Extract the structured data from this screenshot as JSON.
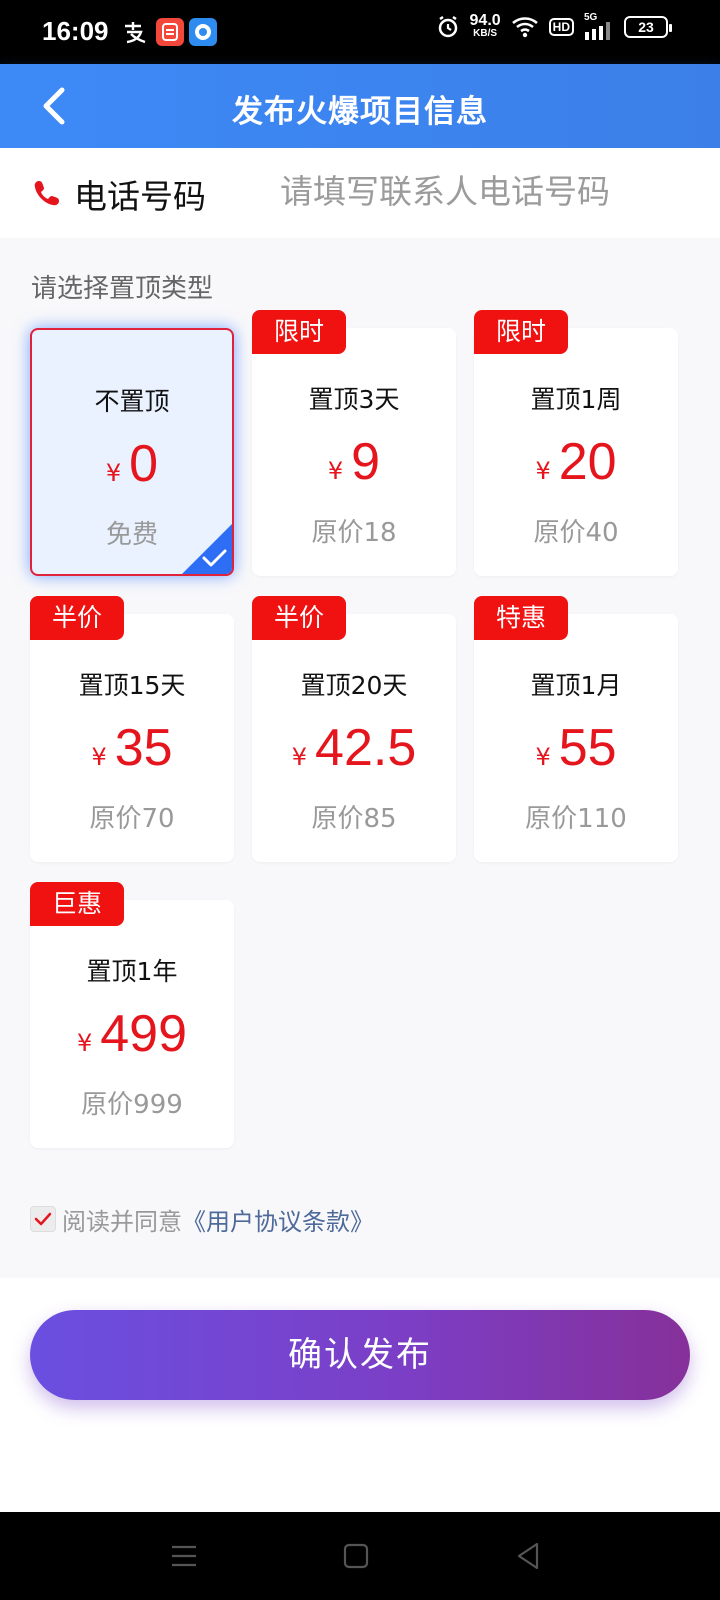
{
  "status_bar": {
    "time": "16:09",
    "speed_top": "94.0",
    "speed_bottom": "KB/S",
    "hd": "HD",
    "net": "5G",
    "battery": "23"
  },
  "header": {
    "title": "发布火爆项目信息"
  },
  "phone": {
    "label": "电话号码",
    "placeholder": "请填写联系人电话号码"
  },
  "section": {
    "title": "请选择置顶类型"
  },
  "options": [
    {
      "badge": "",
      "name": "不置顶",
      "currency": "¥",
      "price": "0",
      "original": "免费",
      "selected": true
    },
    {
      "badge": "限时",
      "name": "置顶3天",
      "currency": "¥",
      "price": "9",
      "original": "原价18",
      "selected": false
    },
    {
      "badge": "限时",
      "name": "置顶1周",
      "currency": "¥",
      "price": "20",
      "original": "原价40",
      "selected": false
    },
    {
      "badge": "半价",
      "name": "置顶15天",
      "currency": "¥",
      "price": "35",
      "original": "原价70",
      "selected": false
    },
    {
      "badge": "半价",
      "name": "置顶20天",
      "currency": "¥",
      "price": "42.5",
      "original": "原价85",
      "selected": false
    },
    {
      "badge": "特惠",
      "name": "置顶1月",
      "currency": "¥",
      "price": "55",
      "original": "原价110",
      "selected": false
    },
    {
      "badge": "巨惠",
      "name": "置顶1年",
      "currency": "¥",
      "price": "499",
      "original": "原价999",
      "selected": false
    }
  ],
  "agreement": {
    "checked": true,
    "text": "阅读并同意",
    "link": "《用户协议条款》"
  },
  "confirm": {
    "label": "确认发布"
  },
  "colors": {
    "primary": "#3d8af7",
    "accent_red": "#e5151d",
    "badge_red": "#f01111",
    "button_start": "#6a4fe0",
    "button_end": "#86309a"
  },
  "icons": {
    "back": "chevron-left-icon",
    "phone": "phone-icon",
    "check": "check-corner-icon",
    "nav_menu": "menu-icon",
    "nav_home": "home-square-icon",
    "nav_back": "triangle-back-icon"
  }
}
